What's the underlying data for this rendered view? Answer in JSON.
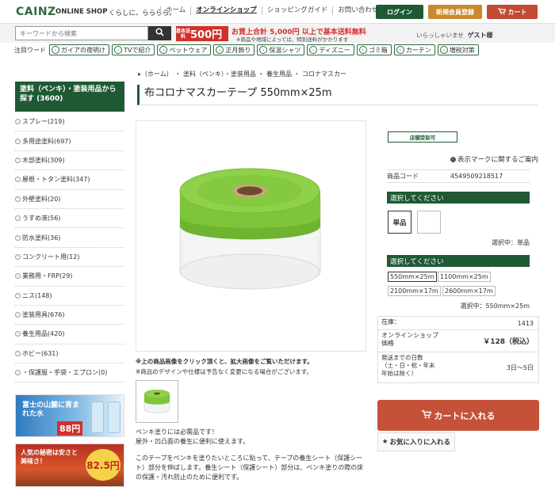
{
  "header": {
    "logo": "CAINZ",
    "shop": "ONLINE SHOP",
    "tagline": "くらしに、らららら。",
    "nav": [
      "ホーム",
      "オンラインショップ",
      "ショッピングガイド",
      "お問い合わせ"
    ],
    "login": "ログイン",
    "register": "新規会員登録",
    "cart": "カート"
  },
  "searchbar": {
    "placeholder": "キーワードから検索",
    "ship_badge_small": "基本送料",
    "ship_badge_price": "500円",
    "ship_text": "お買上合計 5,000円 以上で基本送料無料",
    "ship_note": "※商品や地域によっては、特別送料がかかります",
    "welcome": "いらっしゃいませ",
    "guest": "ゲスト様"
  },
  "keywords": {
    "label": "注目ワード",
    "items": [
      "ガイアの夜明け",
      "TVで紹介",
      "ペットウェア",
      "正月飾り",
      "保温シャツ",
      "ディズニー",
      "ゴミ箱",
      "カーテン",
      "増税対策"
    ]
  },
  "sidebar": {
    "heading": "塗料（ペンキ）・塗装用品から探す (3600)",
    "categories": [
      "スプレー(219)",
      "多用途塗料(697)",
      "木部塗料(309)",
      "屋根・トタン塗料(347)",
      "外壁塗料(20)",
      "うすめ液(56)",
      "防水塗料(36)",
      "コンクリート用(12)",
      "業務用・FRP(29)",
      "ニス(148)",
      "塗装用具(676)",
      "養生用品(420)",
      "ホビー(631)",
      "・保護服・手袋・エプロン(0)"
    ],
    "banner1_text": "富士の山麓に育まれた水",
    "banner1_price": "88円",
    "banner2_text": "人気の秘密は安さと美味さ！",
    "banner2_price": "82.5円"
  },
  "breadcrumb": "（ホーム） ・ 塗料（ペンキ）・塗装用品 ・ 養生用品 ・ コロナマスカー",
  "product": {
    "title": "布コロナマスカーテープ 550mm×25m",
    "note1": "※上の商品画像をクリック頂くと、拡大画像をご覧いただけます。",
    "note2": "※商品のデザインや仕様は予告なく変更になる場合がございます。",
    "desc1": "ペンキ塗りには必需品です！",
    "desc2": "屋外・凹凸面の養生に便利に使えます。",
    "desc3": "このテープをペンキを塗りたいところに貼って、テープの養生シート（保護シート）部分を伸ばします。養生シート（保護シート）部分は、ペンキ塗りの際の床の保護・汚れ防止のために便利です。"
  },
  "panel": {
    "store_badge": "店舗受取可",
    "display_mark": "表示マークに関するご案内",
    "code_label": "商品コード",
    "code_value": "4549509218517",
    "select1_heading": "選択してください",
    "option_single": "単品",
    "selected1": "選択中：単品",
    "select2_heading": "選択してください",
    "sizes": [
      "550mm×25m",
      "1100mm×25m",
      "2100mm×17m",
      "2600mm×17m"
    ],
    "selected2": "選択中：550mm×25m",
    "stock_label": "在庫：",
    "stock_value": "1413",
    "price_label": "オンラインショップ価格",
    "price_value": "￥128（税込）",
    "days_label": "発送までの日数（土・日・祝・年末年始は除く）",
    "days_value": "3日〜5日",
    "cart_button": "カートに入れる",
    "fav_button": "お気に入りに入れる"
  },
  "colors": {
    "brand_green": "#1f5a35",
    "cart_red": "#c65139",
    "ship_red": "#d2302b"
  }
}
